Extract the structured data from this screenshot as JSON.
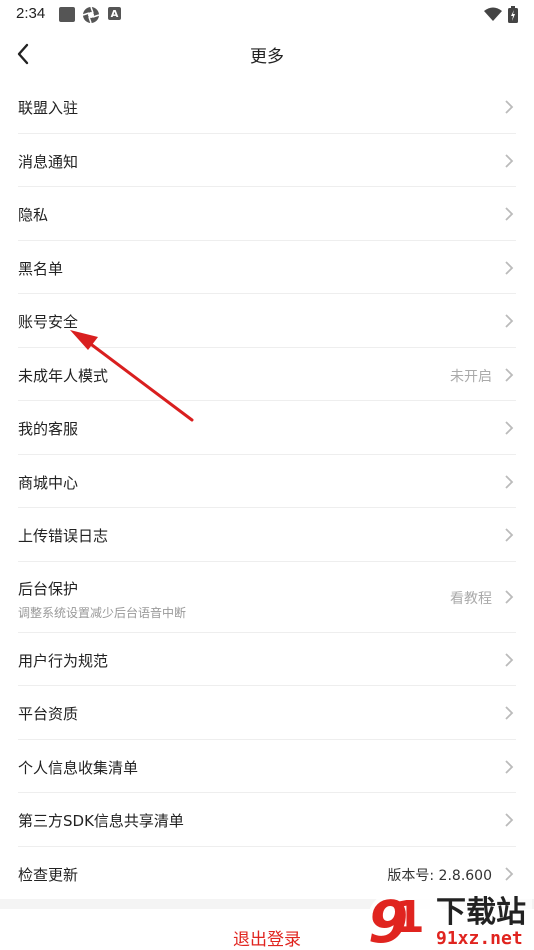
{
  "status_bar": {
    "time": "2:34",
    "icons": [
      "notification-square-icon",
      "aperture-icon",
      "app-a-icon",
      "wifi-icon",
      "battery-icon"
    ]
  },
  "header": {
    "title": "更多",
    "back_icon": "chevron-left-icon"
  },
  "menu": [
    {
      "label": "联盟入驻",
      "value": ""
    },
    {
      "label": "消息通知",
      "value": ""
    },
    {
      "label": "隐私",
      "value": ""
    },
    {
      "label": "黑名单",
      "value": ""
    },
    {
      "label": "账号安全",
      "value": ""
    },
    {
      "label": "未成年人模式",
      "value": "未开启"
    },
    {
      "label": "我的客服",
      "value": ""
    },
    {
      "label": "商城中心",
      "value": ""
    },
    {
      "label": "上传错误日志",
      "value": ""
    },
    {
      "label": "后台保护",
      "sub": "调整系统设置减少后台语音中断",
      "value": "看教程"
    },
    {
      "label": "用户行为规范",
      "value": ""
    },
    {
      "label": "平台资质",
      "value": ""
    },
    {
      "label": "个人信息收集清单",
      "value": ""
    },
    {
      "label": "第三方SDK信息共享清单",
      "value": ""
    },
    {
      "label": "检查更新",
      "value": "版本号: 2.8.600"
    }
  ],
  "logout_label": "退出登录",
  "watermark": {
    "text_main": "下载站",
    "text_sub": "91xz.net",
    "accent": "#e0241f"
  },
  "colors": {
    "accent": "#e0241f",
    "annotation_arrow": "#d91f1f"
  }
}
